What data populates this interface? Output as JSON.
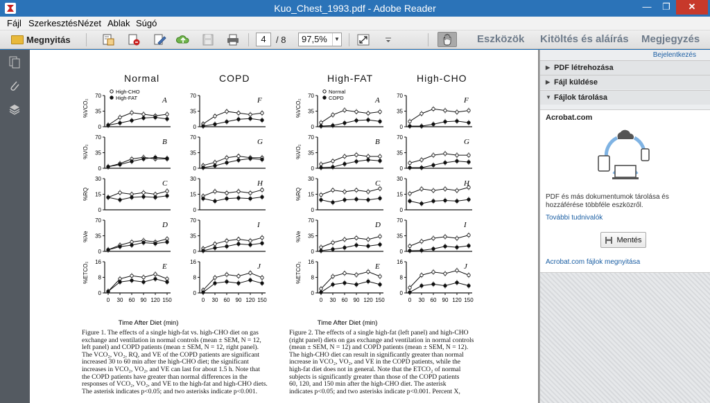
{
  "window": {
    "title": "Kuo_Chest_1993.pdf - Adobe Reader",
    "min_glyph": "—",
    "max_glyph": "❐",
    "close_glyph": "✕"
  },
  "menu": {
    "items": [
      "Fájl",
      "Szerkesztés",
      "Nézet",
      "Ablak",
      "Súgó"
    ]
  },
  "toolbar": {
    "open_label": "Megnyitás",
    "page_current": "4",
    "page_total": "/ 8",
    "zoom": "97,5%",
    "tools_label": "Eszközök",
    "fill_sign_label": "Kitöltés és aláírás",
    "comment_label": "Megjegyzés"
  },
  "right_panel": {
    "login_label": "Bejelentkezés",
    "sections": [
      {
        "label": "PDF létrehozása",
        "arrow": "▶"
      },
      {
        "label": "Fájl küldése",
        "arrow": "▶"
      },
      {
        "label": "Fájlok tárolása",
        "arrow": "▼"
      }
    ],
    "acrobat_title": "Acrobat.com",
    "description": "PDF és más dokumentumok tárolása és hozzáférése többféle eszközről.",
    "more_link": "További tudnivalók",
    "save_button": "Mentés",
    "open_link": "Acrobat.com fájlok megnyitása"
  },
  "document": {
    "left_figure": {
      "headers": [
        "Normal",
        "COPD"
      ],
      "legend": [
        "High-CHO",
        "High-FAT"
      ],
      "y_labels": [
        "%VCO₂",
        "%VO₂",
        "%RQ",
        "%Ve",
        "%ETCO₂"
      ],
      "x_label": "Time After Diet (min)",
      "x_ticks": [
        "0",
        "30",
        "60",
        "90",
        "120",
        "150"
      ],
      "panel_letters_left": [
        "A",
        "B",
        "C",
        "D",
        "E"
      ],
      "panel_letters_right": [
        "F",
        "G",
        "H",
        "I",
        "J"
      ]
    },
    "right_figure": {
      "headers": [
        "High-FAT",
        "High-CHO"
      ],
      "legend": [
        "Normal",
        "COPD"
      ],
      "y_labels": [
        "%VCO₂",
        "%VO₂",
        "%RQ",
        "%Ve",
        "%ETCO₂"
      ],
      "x_label": "Time After Diet (min)",
      "x_ticks": [
        "0",
        "30",
        "60",
        "90",
        "120",
        "150"
      ],
      "panel_letters_left": [
        "A",
        "B",
        "C",
        "D",
        "E"
      ],
      "panel_letters_right": [
        "F",
        "G",
        "H",
        "I",
        "J"
      ]
    },
    "y_ticks": {
      "vco2": [
        "0",
        "35",
        "70"
      ],
      "vo2": [
        "0",
        "35",
        "70"
      ],
      "rq": [
        "0",
        "15",
        "30"
      ],
      "ve": [
        "0",
        "35",
        "70"
      ],
      "etco2": [
        "0",
        "8",
        "16"
      ]
    },
    "caption_left_lines": [
      "Figure 1. The effects of a single high-fat vs. high-CHO diet on gas",
      "exchange and ventilation in normal controls (mean ± SEM, N = 12,",
      "left panel) and COPD patients (mean ± SEM, N = 12, right panel).",
      "The VCO₂, VO₂, RQ, and VE of the COPD patients are significant",
      "increased 30 to 60 min after the high-CHO diet; the significant",
      "increases in VCO₂, VO₂, and VE can last for about 1.5 h. Note that",
      "the COPD patients have greater than normal differences in the",
      "responses of VCO₂, VO₂, and VE to the high-fat and high-CHO diets.",
      "The asterisk indicates p<0.05; and two asterisks indicate p<0.001."
    ],
    "caption_right_lines": [
      "Figure 2. The effects of a single high-fat (left panel) and high-CHO",
      "(right panel) diets on gas exchange and ventilation in normal controls",
      "(mean ± SEM, N = 12) and COPD patients (mean ± SEM, N = 12).",
      "The high-CHO diet can result in significantly greater than normal",
      "increase in VCO₂, VO₂, and VE in the COPD patients, while the",
      "high-fat diet does not in general. Note that the ETCO₂ of normal",
      "subjects is significantly greater than those of the COPD patients",
      "60, 120, and 150 min after the high-CHO diet. The asterisk",
      "indicates p<0.05; and two asterisks indicate p<0.001. Percent X,"
    ]
  }
}
